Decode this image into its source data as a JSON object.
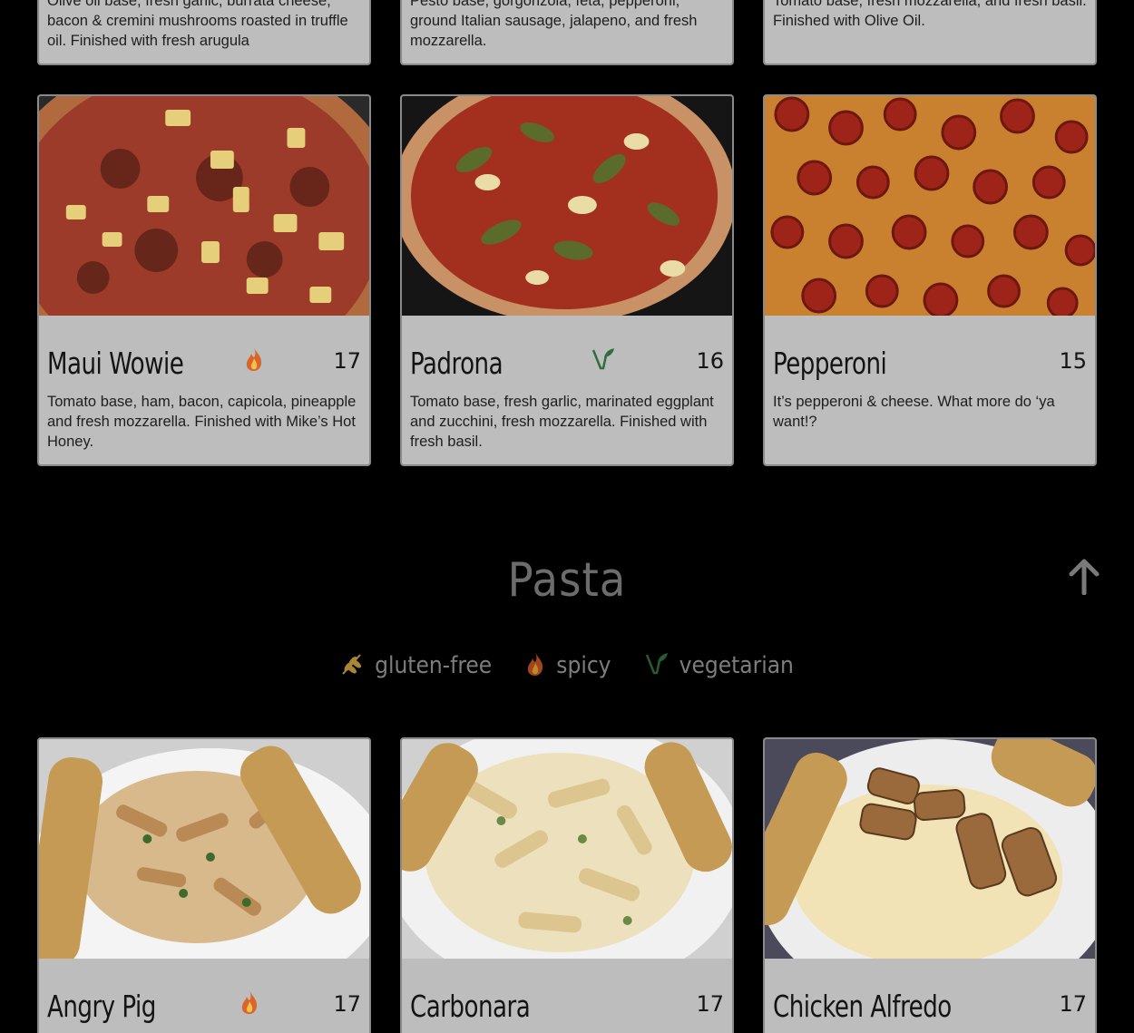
{
  "top_cards": [
    {
      "description": "Olive oil base, fresh garlic, burrata cheese, bacon & cremini mushrooms roasted in truffle oil. Finished with fresh arugula"
    },
    {
      "description": "Pesto base, gorgonzola, feta, pepperoni, ground Italian sausage, jalapeno, and fresh mozzarella."
    },
    {
      "description": "Tomato base, fresh mozzarella, and fresh basil. Finished with Olive Oil."
    }
  ],
  "pizza_cards": [
    {
      "title": "Maui Wowie",
      "badge": "spicy-icon",
      "price": "17",
      "description": "Tomato base, ham, bacon, capicola, pineapple and fresh mozzarella. Finished with Mike’s Hot Honey."
    },
    {
      "title": "Padrona",
      "badge": "vegetarian-icon",
      "price": "16",
      "description": "Tomato base, fresh garlic, marinated eggplant and zucchini, fresh mozzarella. Finished with fresh basil."
    },
    {
      "title": "Pepperoni",
      "badge": "",
      "price": "15",
      "description": "It’s pepperoni & cheese. What more do ‘ya want!?"
    }
  ],
  "pasta_section": {
    "title": "Pasta",
    "legend": [
      {
        "icon": "gluten-free-icon",
        "label": "gluten-free"
      },
      {
        "icon": "spicy-icon",
        "label": "spicy"
      },
      {
        "icon": "vegetarian-icon",
        "label": "vegetarian"
      }
    ],
    "cards": [
      {
        "title": "Angry Pig",
        "badge": "spicy-icon",
        "price": "17"
      },
      {
        "title": "Carbonara",
        "badge": "",
        "price": "17"
      },
      {
        "title": "Chicken Alfredo",
        "badge": "",
        "price": "17"
      }
    ]
  },
  "colors": {
    "background": "#000000",
    "card": "#bdbdbd",
    "spicy": "#d9652a",
    "vegetarian": "#2f6e3c",
    "gluten_free": "#a88636"
  }
}
